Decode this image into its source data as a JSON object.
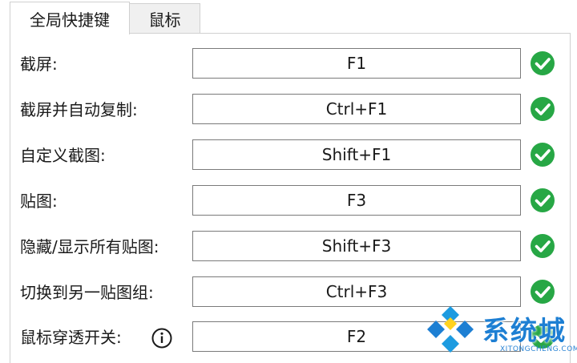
{
  "tabs": {
    "active_label": "全局快捷键",
    "inactive_label": "鼠标"
  },
  "rows": [
    {
      "label": "截屏:",
      "hotkey": "F1",
      "status": "ok"
    },
    {
      "label": "截屏并自动复制:",
      "hotkey": "Ctrl+F1",
      "status": "ok"
    },
    {
      "label": "自定义截图:",
      "hotkey": "Shift+F1",
      "status": "ok"
    },
    {
      "label": "贴图:",
      "hotkey": "F3",
      "status": "ok"
    },
    {
      "label": "隐藏/显示所有贴图:",
      "hotkey": "Shift+F3",
      "status": "ok"
    },
    {
      "label": "切换到另一贴图组:",
      "hotkey": "Ctrl+F3",
      "status": "ok"
    },
    {
      "label": "鼠标穿透开关:",
      "hotkey": "F2",
      "status": "ok"
    }
  ],
  "watermark": {
    "title": "系统城",
    "subtitle": "XITONGCHENG.COM"
  },
  "colors": {
    "check_green": "#27a745",
    "watermark_blue": "#1d7fd3"
  },
  "icons": {
    "status": "check-circle-icon",
    "info": "info-icon"
  }
}
